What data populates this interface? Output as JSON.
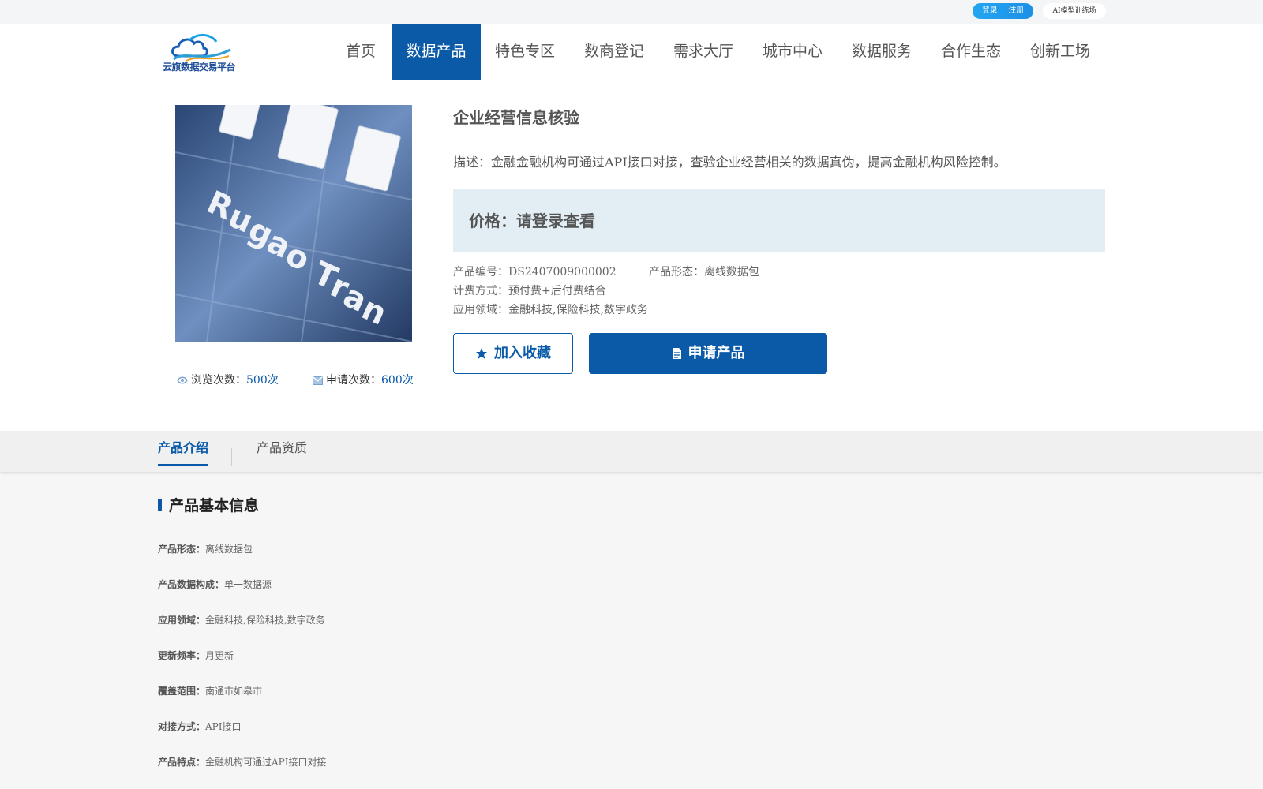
{
  "topbar": {
    "login": "登录",
    "sep": "|",
    "register": "注册",
    "ai_training": "AI模型训练场"
  },
  "header": {
    "logo_text": "云旗数据交易平台",
    "nav": [
      {
        "label": "首页"
      },
      {
        "label": "数据产品",
        "active": true
      },
      {
        "label": "特色专区"
      },
      {
        "label": "数商登记"
      },
      {
        "label": "需求大厅"
      },
      {
        "label": "城市中心"
      },
      {
        "label": "数据服务"
      },
      {
        "label": "合作生态"
      },
      {
        "label": "创新工场"
      }
    ]
  },
  "product": {
    "image_alt_text": "如皋市 Rugao Tran",
    "title": "企业经营信息核验",
    "description": "描述：金融金融机构可通过API接口对接，查验企业经营相关的数据真伪，提高金融机构风险控制。",
    "price": "价格：请登录查看",
    "code": "产品编号：DS2407009000002",
    "form": "产品形态：离线数据包",
    "billing": "计费方式：预付费+后付费结合",
    "domain": "应用领域：金融科技,保险科技,数字政务",
    "views_label": "浏览次数：",
    "views_value": "500次",
    "applies_label": "申请次数：",
    "applies_value": "600次",
    "favorite_button": "加入收藏",
    "apply_button": "申请产品"
  },
  "tabs": [
    {
      "label": "产品介绍",
      "active": true
    },
    {
      "label": "产品资质"
    }
  ],
  "basic_info": {
    "heading": "产品基本信息",
    "rows": [
      {
        "key": "产品形态：",
        "value": "离线数据包"
      },
      {
        "key": "产品数据构成：",
        "value": "单一数据源"
      },
      {
        "key": "应用领域：",
        "value": "金融科技,保险科技,数字政务"
      },
      {
        "key": "更新频率：",
        "value": "月更新"
      },
      {
        "key": "覆盖范围：",
        "value": "南通市如皋市"
      },
      {
        "key": "对接方式：",
        "value": "API接口"
      },
      {
        "key": "产品特点：",
        "value": "金融机构可通过API接口对接"
      }
    ]
  },
  "colors": {
    "primary": "#0a5aa8",
    "price_bg": "#e2eef3",
    "login_pill": "#1b8fe6"
  }
}
